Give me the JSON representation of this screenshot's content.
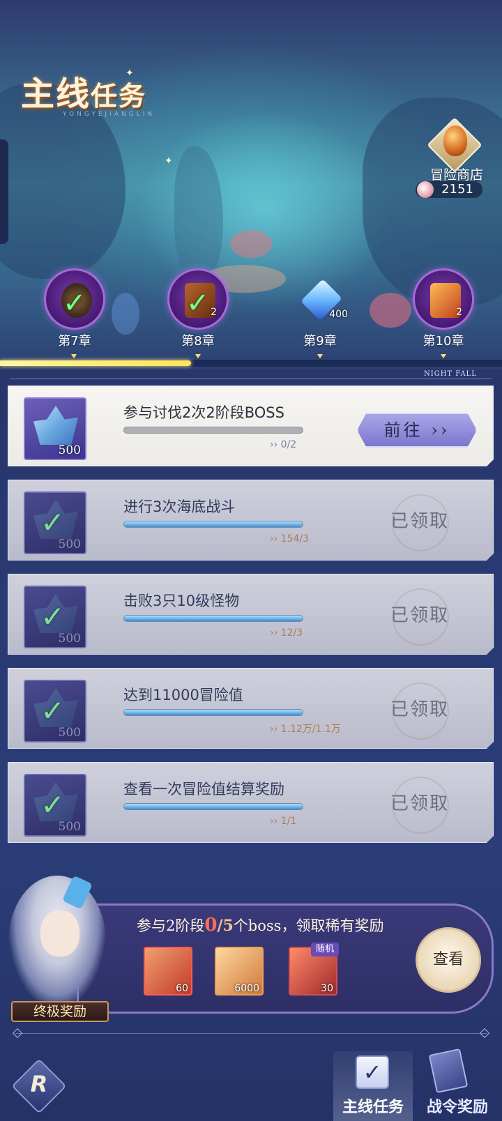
{
  "header": {
    "title_part1": "主线",
    "title_part2": "任务",
    "title_sub": "YONGYEJIANGLIN"
  },
  "shop": {
    "label": "冒险商店",
    "currency": "2151"
  },
  "chapters": [
    {
      "label": "第7章",
      "completed": true,
      "count": ""
    },
    {
      "label": "第8章",
      "completed": true,
      "count": "2"
    },
    {
      "label": "第9章",
      "completed": false,
      "count": "400"
    },
    {
      "label": "第10章",
      "completed": false,
      "count": "2"
    }
  ],
  "chapter_progress_fraction": 0.38,
  "nightfall": "NIGHT FALL",
  "tasks": [
    {
      "name": "参与讨伐2次2阶段BOSS",
      "progress": "0/2",
      "reward_qty": "500",
      "state": "active",
      "button": "前往",
      "fill": 0.0
    },
    {
      "name": "进行3次海底战斗",
      "progress": "154/3",
      "reward_qty": "500",
      "state": "done",
      "button": "已领取",
      "fill": 1.0
    },
    {
      "name": "击败3只10级怪物",
      "progress": "12/3",
      "reward_qty": "500",
      "state": "done",
      "button": "已领取",
      "fill": 1.0
    },
    {
      "name": "达到11000冒险值",
      "progress": "1.12万/1.1万",
      "reward_qty": "500",
      "state": "done",
      "button": "已领取",
      "fill": 1.0
    },
    {
      "name": "查看一次冒险值结算奖励",
      "progress": "1/1",
      "reward_qty": "500",
      "state": "done",
      "button": "已领取",
      "fill": 1.0
    }
  ],
  "ultimate": {
    "title_a": "参与2阶段",
    "current": "0",
    "slash_total": "/5",
    "title_b": "个boss，领取稀有奖励",
    "items": [
      {
        "qty": "60"
      },
      {
        "qty": "6000"
      },
      {
        "qty": "30",
        "tag": "随机"
      }
    ],
    "view_button": "查看",
    "label": "终极奖励"
  },
  "nav": {
    "tab_main": "主线任务",
    "tab_pass": "战令奖励"
  },
  "colors": {
    "progress_yellow": "#ffe35a",
    "task_bar_blue": "#3a8fd8",
    "highlight_red": "#ff6d5a",
    "button_purple": "#7c78cc"
  }
}
